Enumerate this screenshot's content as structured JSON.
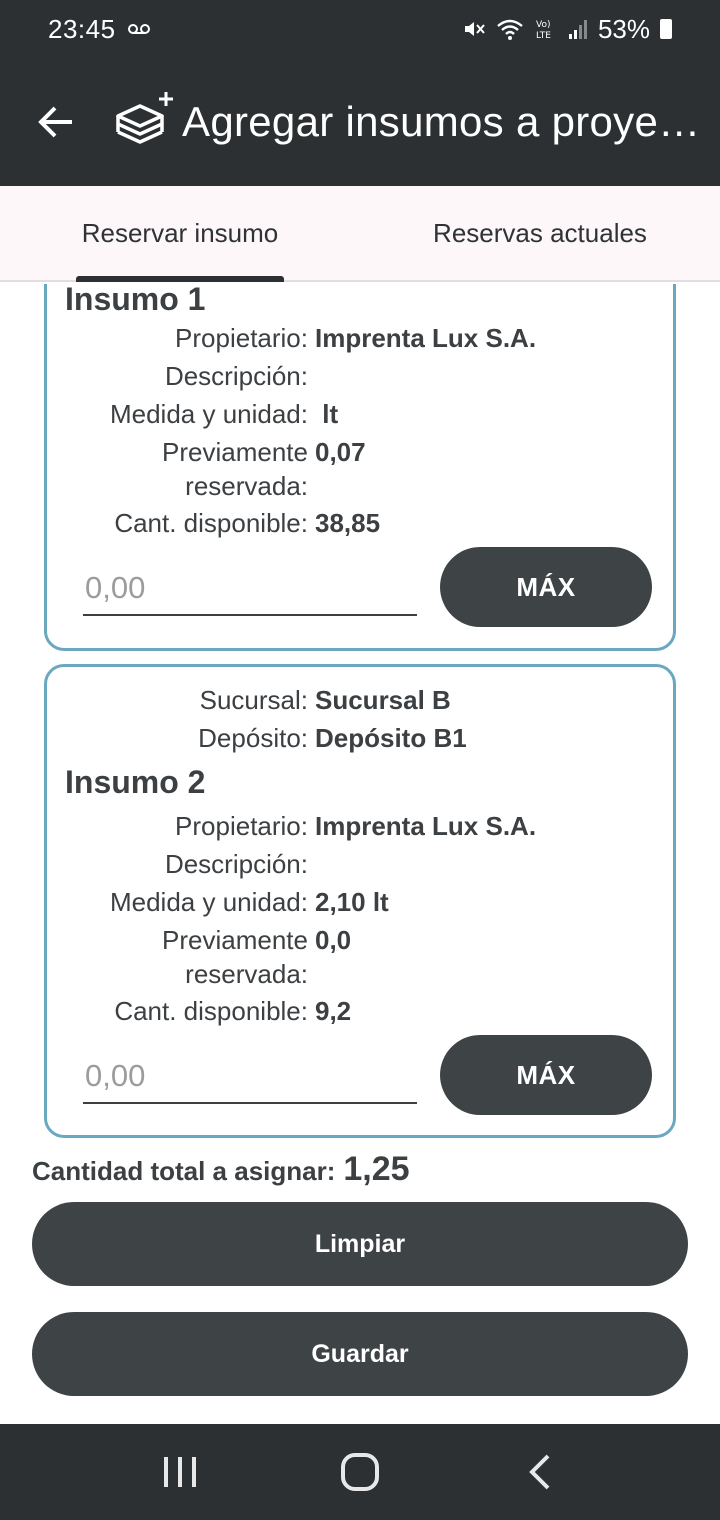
{
  "status_bar": {
    "time": "23:45",
    "battery": "53%",
    "icons": [
      "voicemail-icon",
      "mute-icon",
      "wifi-icon",
      "volte-icon",
      "signal-icon",
      "battery-icon"
    ]
  },
  "app_bar": {
    "title": "Agregar insumos a proyecto",
    "back_icon": "arrow-left-icon",
    "app_icon": "boxes-add-icon"
  },
  "tabs": [
    {
      "label": "Reservar insumo",
      "active": true
    },
    {
      "label": "Reservas actuales",
      "active": false
    }
  ],
  "labels": {
    "sucursal": "Sucursal:",
    "deposito": "Depósito:",
    "propietario": "Propietario:",
    "descripcion": "Descripción:",
    "medida": "Medida y unidad:",
    "previamente": "Previamente reservada:",
    "disponible": "Cant. disponible:"
  },
  "items": [
    {
      "title": "Insumo 1",
      "propietario": "Imprenta Lux S.A.",
      "descripcion": "",
      "medida": " lt",
      "previamente": "0,07",
      "disponible": "38,85",
      "input_placeholder": "0,00",
      "max_label": "MÁX"
    },
    {
      "sucursal": "Sucursal B",
      "deposito": "Depósito B1",
      "title": "Insumo 2",
      "propietario": "Imprenta Lux S.A.",
      "descripcion": "",
      "medida": "2,10 lt",
      "previamente": "0,0",
      "disponible": "9,2",
      "input_placeholder": "0,00",
      "max_label": "MÁX"
    }
  ],
  "total": {
    "label": "Cantidad total a asignar:",
    "value": "1,25"
  },
  "buttons": {
    "clear": "Limpiar",
    "save": "Guardar"
  },
  "colors": {
    "dark": "#2c3033",
    "button": "#3e4346",
    "card_border": "#6aa8c0",
    "tabs_bg": "#fdf7fa"
  },
  "nav_icons": [
    "recent-apps-icon",
    "home-icon",
    "back-icon"
  ]
}
